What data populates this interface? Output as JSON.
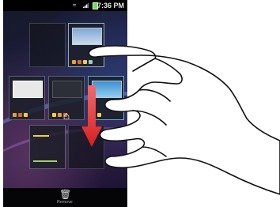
{
  "status_bar": {
    "time": "7:36 PM",
    "icons": [
      "wifi-icon",
      "signal-icon",
      "battery-icon"
    ]
  },
  "home_screen_panels": [
    {
      "name": "panel-1",
      "state": "empty"
    },
    {
      "name": "panel-2",
      "state": "selected",
      "widget": "picture-widget"
    },
    {
      "name": "panel-3",
      "state": "filled",
      "widget": "white-widget"
    },
    {
      "name": "panel-4",
      "state": "filled",
      "widget": "dark-widget"
    },
    {
      "name": "panel-5",
      "state": "filled",
      "widget": "weather-widget"
    },
    {
      "name": "panel-6",
      "state": "filled",
      "widget": "clock-widget"
    },
    {
      "name": "panel-7",
      "state": "empty"
    }
  ],
  "gesture": {
    "hand": "pointing-hand-icon",
    "arrow": "red-down-arrow-icon",
    "arrow_color": "#e23b3b"
  },
  "trash": {
    "icon": "trash-can-icon",
    "label": "Remove"
  },
  "colors": {
    "wallpaper": "#1c1e3c",
    "status_bar": "#000000"
  }
}
